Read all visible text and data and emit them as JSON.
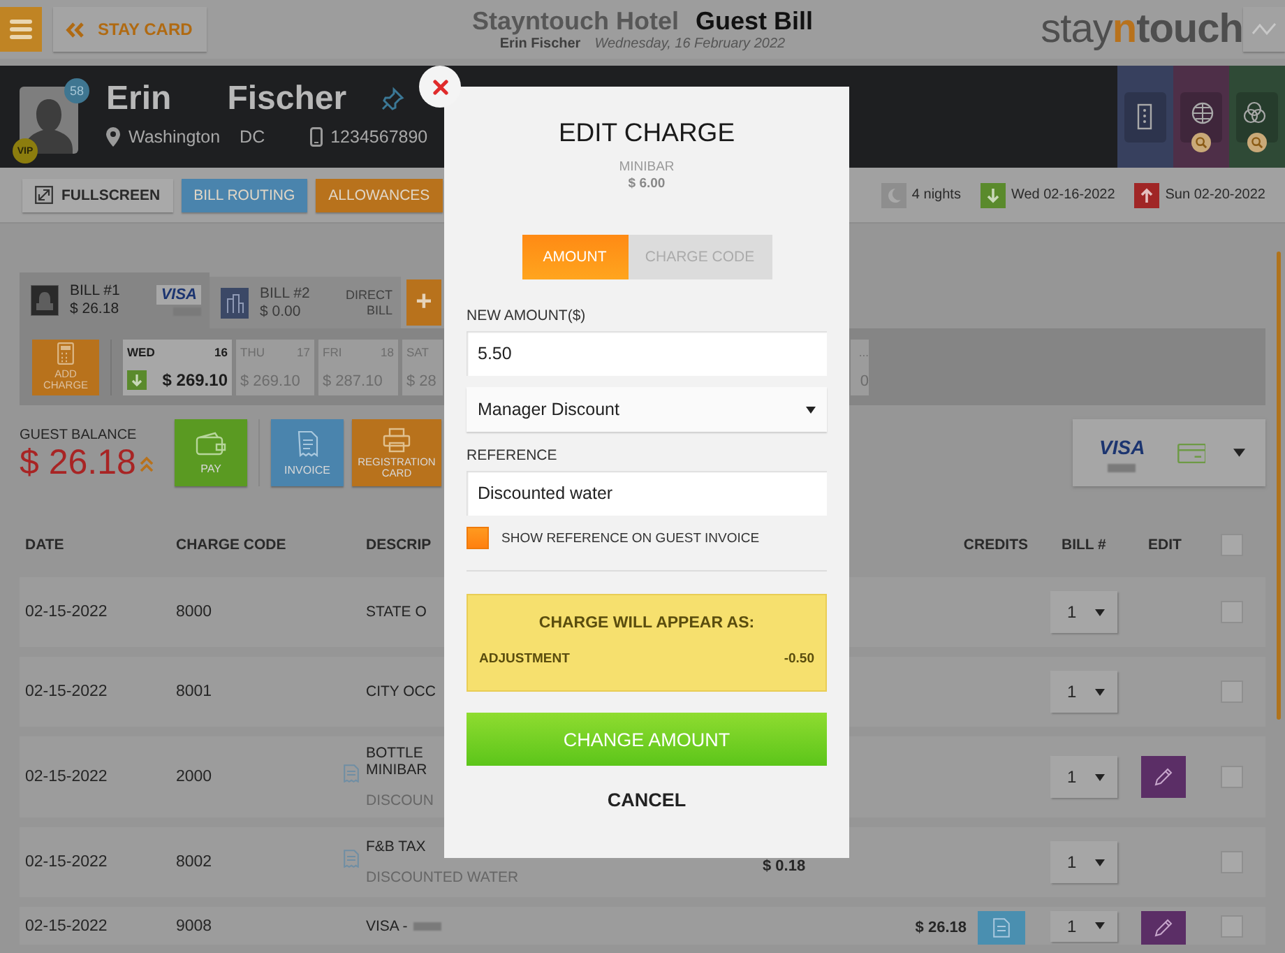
{
  "header": {
    "back_button": "STAY CARD",
    "hotel": "Stayntouch Hotel",
    "page_title": "Guest Bill",
    "guest_name": "Erin Fischer",
    "date": "Wednesday, 16 February 2022",
    "logo": [
      {
        "text": "stay",
        "accent": false
      },
      {
        "text": "n",
        "accent": true
      },
      {
        "text": "touch",
        "accent": false
      }
    ]
  },
  "guest": {
    "first_name": "Erin",
    "last_name": "Fischer",
    "stay_count": "58",
    "vip": "VIP",
    "city": "Washington",
    "state": "DC",
    "phone": "1234567890",
    "tiles": [
      {
        "kind": "door",
        "color": "#37405e",
        "search": false
      },
      {
        "kind": "globe",
        "color": "#4e2f48",
        "search": true
      },
      {
        "kind": "rings",
        "color": "#2f4a36",
        "search": true
      }
    ]
  },
  "toolbar": {
    "buttons": [
      {
        "label": "FULLSCREEN",
        "kind": "icon"
      },
      {
        "label": "BILL ROUTING",
        "kind": "filled",
        "color": "#4a84ad"
      },
      {
        "label": "ALLOWANCES",
        "kind": "filled",
        "color": "#b8721c"
      }
    ],
    "nights": "4 nights",
    "arrival": "Wed 02-16-2022",
    "departure": "Sun 02-20-2022"
  },
  "bills": [
    {
      "label": "BILL #1",
      "amount": "$ 26.18",
      "selected": true,
      "kind": "card",
      "card": "VISA"
    },
    {
      "label": "BILL #2",
      "amount": "$ 0.00",
      "selected": false,
      "kind": "direct",
      "note": "DIRECT BILL"
    }
  ],
  "add_bill": "+",
  "add_charge": "ADD CHARGE",
  "days": [
    {
      "day": "WED",
      "date": "16",
      "amount": "$ 269.10",
      "selected": true
    },
    {
      "day": "THU",
      "date": "17",
      "amount": "$ 269.10",
      "selected": false
    },
    {
      "day": "FRI",
      "date": "18",
      "amount": "$ 287.10",
      "selected": false
    },
    {
      "day": "SAT",
      "amount": "$ 28",
      "selected": false
    },
    {
      "day": "...",
      "amount": "0",
      "selected": false
    }
  ],
  "balance": {
    "label": "GUEST BALANCE",
    "amount": "$ 26.18"
  },
  "actions": [
    {
      "label": "PAY",
      "kind": "pay"
    },
    {
      "label": "INVOICE",
      "kind": "invoice"
    },
    {
      "label": "REGISTRATION CARD",
      "kind": "registration"
    }
  ],
  "payment": {
    "card": "VISA"
  },
  "table": {
    "columns": [
      "DATE",
      "CHARGE CODE",
      "DESCRIP",
      "CREDITS",
      "BILL #",
      "EDIT"
    ],
    "all_checked": false,
    "rows": [
      {
        "date": "02-15-2022",
        "code": "8000",
        "reference": false,
        "title": "STATE O",
        "masked": false,
        "bill": "1",
        "editable": false,
        "invoice": false,
        "checked": false
      },
      {
        "date": "02-15-2022",
        "code": "8001",
        "reference": false,
        "title": "CITY OCC",
        "masked": false,
        "bill": "1",
        "editable": false,
        "invoice": false,
        "checked": false
      },
      {
        "date": "02-15-2022",
        "code": "2000",
        "reference": true,
        "title": "BOTTLE",
        "subtitle": "MINIBAR",
        "note": "DISCOUN",
        "masked": false,
        "bill": "1",
        "editable": true,
        "invoice": false,
        "checked": false
      },
      {
        "date": "02-15-2022",
        "code": "8002",
        "reference": true,
        "title": "F&B TAX",
        "note": "DISCOUNTED WATER",
        "masked": false,
        "charge": "$ 0.18",
        "bill": "1",
        "editable": false,
        "invoice": false,
        "checked": false
      },
      {
        "date": "02-15-2022",
        "code": "9008",
        "reference": false,
        "title": "VISA -",
        "masked": true,
        "credit": "$ 26.18",
        "bill": "1",
        "editable": true,
        "invoice": true,
        "checked": false
      }
    ]
  },
  "modal": {
    "title": "EDIT CHARGE",
    "item": "MINIBAR",
    "price": "$ 6.00",
    "tabs": [
      {
        "label": "AMOUNT",
        "selected": true
      },
      {
        "label": "CHARGE CODE",
        "selected": false
      }
    ],
    "amount_label": "NEW AMOUNT($)",
    "amount": "5.50",
    "reason": "Manager Discount",
    "reference_label": "REFERENCE",
    "reference": "Discounted water",
    "show_reference": {
      "label": "SHOW REFERENCE ON GUEST INVOICE",
      "checked": true
    },
    "preview": {
      "title": "CHARGE WILL APPEAR AS:",
      "name": "ADJUSTMENT",
      "amount": "-0.50"
    },
    "submit": "CHANGE AMOUNT",
    "cancel": "CANCEL"
  }
}
